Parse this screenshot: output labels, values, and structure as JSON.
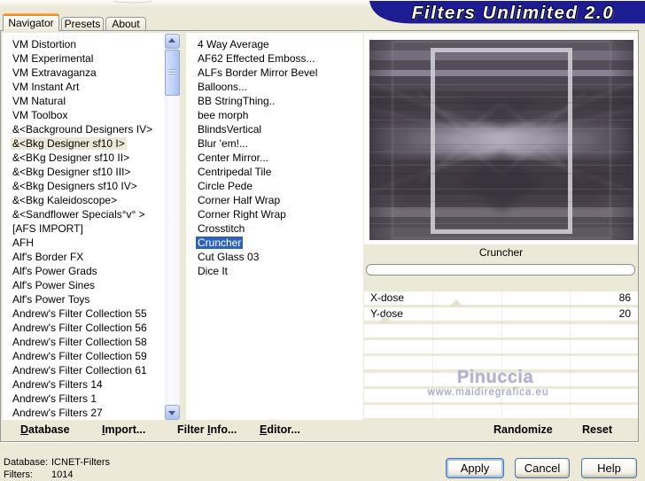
{
  "window": {
    "banner_title": "Filters Unlimited 2.0"
  },
  "tabs": [
    {
      "label": "Navigator",
      "active": true
    },
    {
      "label": "Presets",
      "active": false
    },
    {
      "label": "About",
      "active": false
    }
  ],
  "category_list": {
    "selected_index": 7,
    "items": [
      "VM Distortion",
      "VM Experimental",
      "VM Extravaganza",
      "VM Instant Art",
      "VM Natural",
      "VM Toolbox",
      "&<Background Designers IV>",
      "&<Bkg Designer sf10 I>",
      "&<BKg Designer sf10 II>",
      "&<Bkg Designer sf10 III>",
      "&<Bkg Designers sf10 IV>",
      "&<Bkg Kaleidoscope>",
      "&<Sandflower Specials°v° >",
      "[AFS IMPORT]",
      "AFH",
      "Alf's Border FX",
      "Alf's Power Grads",
      "Alf's Power Sines",
      "Alf's Power Toys",
      "Andrew's Filter Collection 55",
      "Andrew's Filter Collection 56",
      "Andrew's Filter Collection 58",
      "Andrew's Filter Collection 59",
      "Andrew's Filter Collection 61",
      "Andrew's Filters 14",
      "Andrew's Filters 1",
      "Andrew's Filters 27"
    ]
  },
  "filter_list": {
    "selected_index": 14,
    "items": [
      "4 Way Average",
      "AF62 Effected Emboss...",
      "ALFs Border Mirror Bevel",
      "Balloons...",
      "BB StringThing..",
      "bee morph",
      "BlindsVertical",
      "Blur 'em!...",
      "Center Mirror...",
      "Centripedal Tile",
      "Circle Pede",
      "Corner Half Wrap",
      "Corner Right Wrap",
      "Crosstitch",
      "Cruncher",
      "Cut Glass 03",
      "Dice It"
    ]
  },
  "preview": {
    "filter_name": "Cruncher",
    "progress_percent": 0
  },
  "parameters": {
    "visible_slots": 8,
    "max": 255,
    "items": [
      {
        "name": "X-dose",
        "value": 86
      },
      {
        "name": "Y-dose",
        "value": 20
      }
    ]
  },
  "watermark": {
    "line1": "Pinuccia",
    "line2": "www.maidiregrafica.eu"
  },
  "toolbar": {
    "database": {
      "pre": "",
      "u": "D",
      "post": "atabase"
    },
    "import": {
      "pre": "",
      "u": "I",
      "post": "mport..."
    },
    "filter_info": {
      "pre": "Filter ",
      "u": "I",
      "post": "nfo..."
    },
    "editor": {
      "pre": "",
      "u": "E",
      "post": "ditor..."
    },
    "randomize": "Randomize",
    "reset": "Reset"
  },
  "status": {
    "database_label": "Database:",
    "database_value": "ICNET-Filters",
    "filters_label": "Filters:",
    "filters_value": "1014"
  },
  "buttons": {
    "apply": "Apply",
    "cancel": "Cancel",
    "help": "Help"
  },
  "colors": {
    "dialog_bg": "#ece9d8",
    "banner_navy": "#1e1c92",
    "selection_blue": "#2e63b8",
    "inactive_selection": "#ebe8d5",
    "page_border": "#919b9c",
    "tab_accent_orange": "#e5832e",
    "watermark_lavender": "#b4b2d0"
  }
}
